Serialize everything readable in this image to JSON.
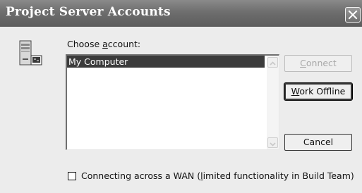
{
  "window": {
    "title": "Project Server Accounts",
    "close_icon": "close-icon"
  },
  "dialog": {
    "icon": "server-icon",
    "choose_label_prefix": "Choose ",
    "choose_label_mnemonic": "a",
    "choose_label_suffix": "ccount:",
    "accounts": [
      {
        "label": "My Computer",
        "selected": true
      }
    ],
    "buttons": {
      "connect": {
        "label_mnemonic": "C",
        "label_rest": "onnect",
        "enabled": false
      },
      "work_offline": {
        "label_mnemonic": "W",
        "label_rest": "ork Offline",
        "enabled": true,
        "default": true
      },
      "cancel": {
        "label": "Cancel",
        "enabled": true
      }
    },
    "wan_checkbox": {
      "checked": false,
      "label_prefix": "Connecting across a WAN (",
      "label_mnemonic": "l",
      "label_suffix": "imited functionality in Build Team)"
    }
  }
}
